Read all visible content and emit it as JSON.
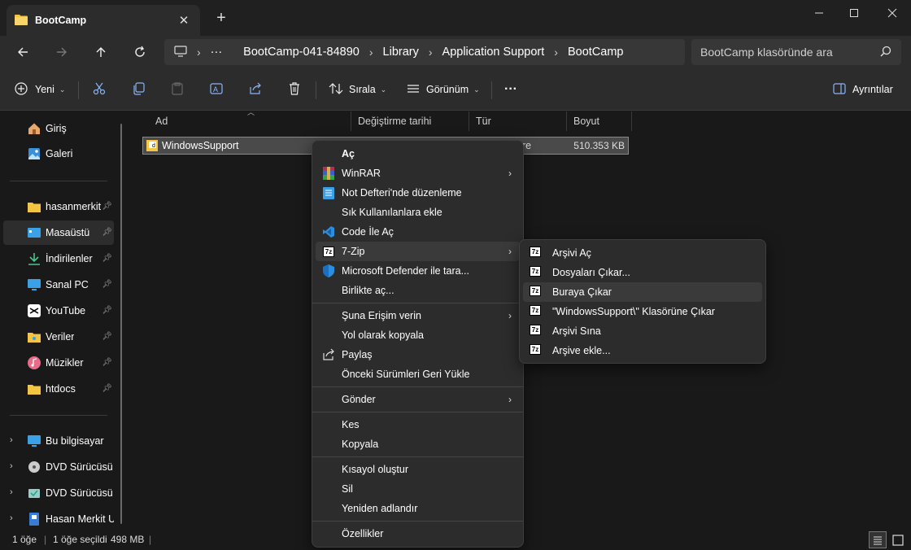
{
  "window": {
    "tab_title": "BootCamp",
    "new_tab": "+",
    "close_tab": "✕"
  },
  "nav": {
    "breadcrumbs": [
      "BootCamp-041-84890",
      "Library",
      "Application Support",
      "BootCamp"
    ],
    "overflow": "···",
    "search_placeholder": "BootCamp klasöründe ara"
  },
  "toolbar": {
    "new_label": "Yeni",
    "sort_label": "Sırala",
    "view_label": "Görünüm",
    "more_label": "···",
    "details_label": "Ayrıntılar"
  },
  "sidebar": {
    "items": [
      {
        "label": "Giriş",
        "icon": "home-icon"
      },
      {
        "label": "Galeri",
        "icon": "gallery-icon"
      },
      {
        "label": "hasanmerkit",
        "icon": "folder-icon"
      },
      {
        "label": "Masaüstü",
        "icon": "desktop-icon"
      },
      {
        "label": "İndirilenler",
        "icon": "download-icon"
      },
      {
        "label": "Sanal PC",
        "icon": "monitor-icon"
      },
      {
        "label": "YouTube",
        "icon": "capcut-icon"
      },
      {
        "label": "Veriler",
        "icon": "folder-icon"
      },
      {
        "label": "Müzikler",
        "icon": "music-icon"
      },
      {
        "label": "htdocs",
        "icon": "folder-icon"
      },
      {
        "label": "Bu bilgisayar",
        "icon": "pc-icon"
      },
      {
        "label": "DVD Sürücüsü (I",
        "icon": "dvd-icon"
      },
      {
        "label": "DVD Sürücüsü (I",
        "icon": "dvd-icon"
      },
      {
        "label": "Hasan Merkit US",
        "icon": "usb-icon"
      }
    ]
  },
  "columns": {
    "name": "Ad",
    "modified": "Değiştirme tarihi",
    "type": "Tür",
    "size": "Boyut"
  },
  "file": {
    "name": "WindowsSupport",
    "type_fragment": "re",
    "size": "510.353 KB"
  },
  "context_menu": {
    "items": [
      "Aç",
      "WinRAR",
      "Not Defteri'nde düzenleme",
      "Sık Kullanılanlara ekle",
      "Code İle Aç",
      "7-Zip",
      "Microsoft Defender ile tara...",
      "Birlikte aç...",
      "Şuna Erişim verin",
      "Yol olarak kopyala",
      "Paylaş",
      "Önceki Sürümleri Geri Yükle",
      "Gönder",
      "Kes",
      "Kopyala",
      "Kısayol oluştur",
      "Sil",
      "Yeniden adlandır",
      "Özellikler"
    ]
  },
  "submenu": {
    "items": [
      "Arşivi Aç",
      "Dosyaları Çıkar...",
      "Buraya Çıkar",
      "\"WindowsSupport\\\" Klasörüne Çıkar",
      "Arşivi Sına",
      "Arşive ekle..."
    ],
    "icon_text": "7z"
  },
  "status": {
    "count": "1 öğe",
    "selected": "1 öğe seçildi",
    "size": "498 MB"
  },
  "colors": {
    "accent": "#0078d4",
    "folder": "#f4c542"
  }
}
